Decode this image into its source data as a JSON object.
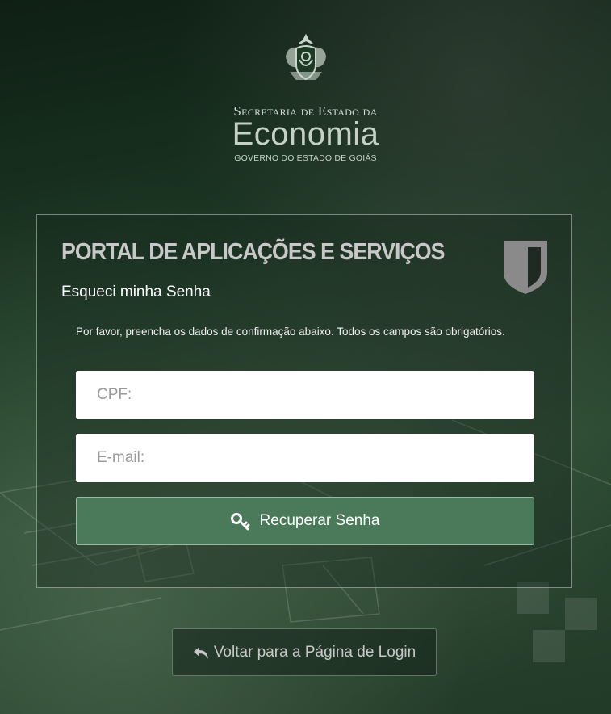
{
  "logo": {
    "line1": "Secretaria de Estado da",
    "line2": "Economia",
    "line3": "GOVERNO DO ESTADO DE GOIÁS"
  },
  "panel": {
    "title": "PORTAL DE APLICAÇÕES E SERVIÇOS",
    "subtitle": "Esqueci minha Senha",
    "instructions": "Por favor, preencha os dados de confirmação abaixo. Todos os campos são obrigatórios."
  },
  "form": {
    "cpf_placeholder": "CPF:",
    "email_placeholder": "E-mail:",
    "submit_label": "Recuperar Senha",
    "submit_icon": "key-icon"
  },
  "footer": {
    "back_label": "Voltar para a Página de Login",
    "back_icon": "reply-arrow-icon"
  },
  "colors": {
    "button_green": "#4a7a5a",
    "background_dark_green": "#1d3a25"
  }
}
